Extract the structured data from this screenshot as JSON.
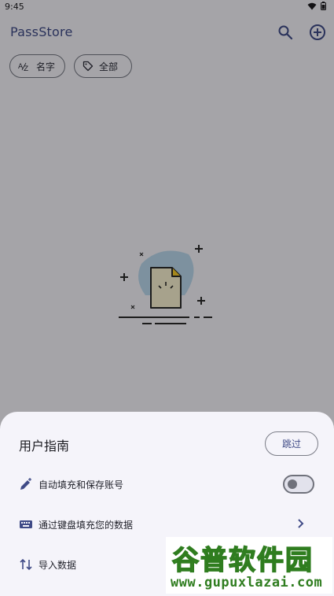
{
  "status_bar": {
    "time": "9:45"
  },
  "app_bar": {
    "title": "PassStore"
  },
  "chips": {
    "sort_label": "名字",
    "filter_label": "全部"
  },
  "sheet": {
    "title": "用户指南",
    "skip_label": "跳过",
    "rows": [
      {
        "label": "自动填充和保存账号",
        "icon": "pen-sparkle-icon",
        "control": "toggle",
        "toggle_on": false
      },
      {
        "label": "通过键盘填充您的数据",
        "icon": "keyboard-icon",
        "control": "chevron"
      },
      {
        "label": "导入数据",
        "icon": "swap-vertical-icon",
        "control": "none"
      }
    ]
  },
  "watermark": {
    "text": "谷普软件园",
    "url": "www.gupuxlazai.com"
  },
  "colors": {
    "accent": "#3f4a86",
    "scrim": "rgba(0,0,0,0.32)",
    "sheet": "#f5f4fa"
  }
}
